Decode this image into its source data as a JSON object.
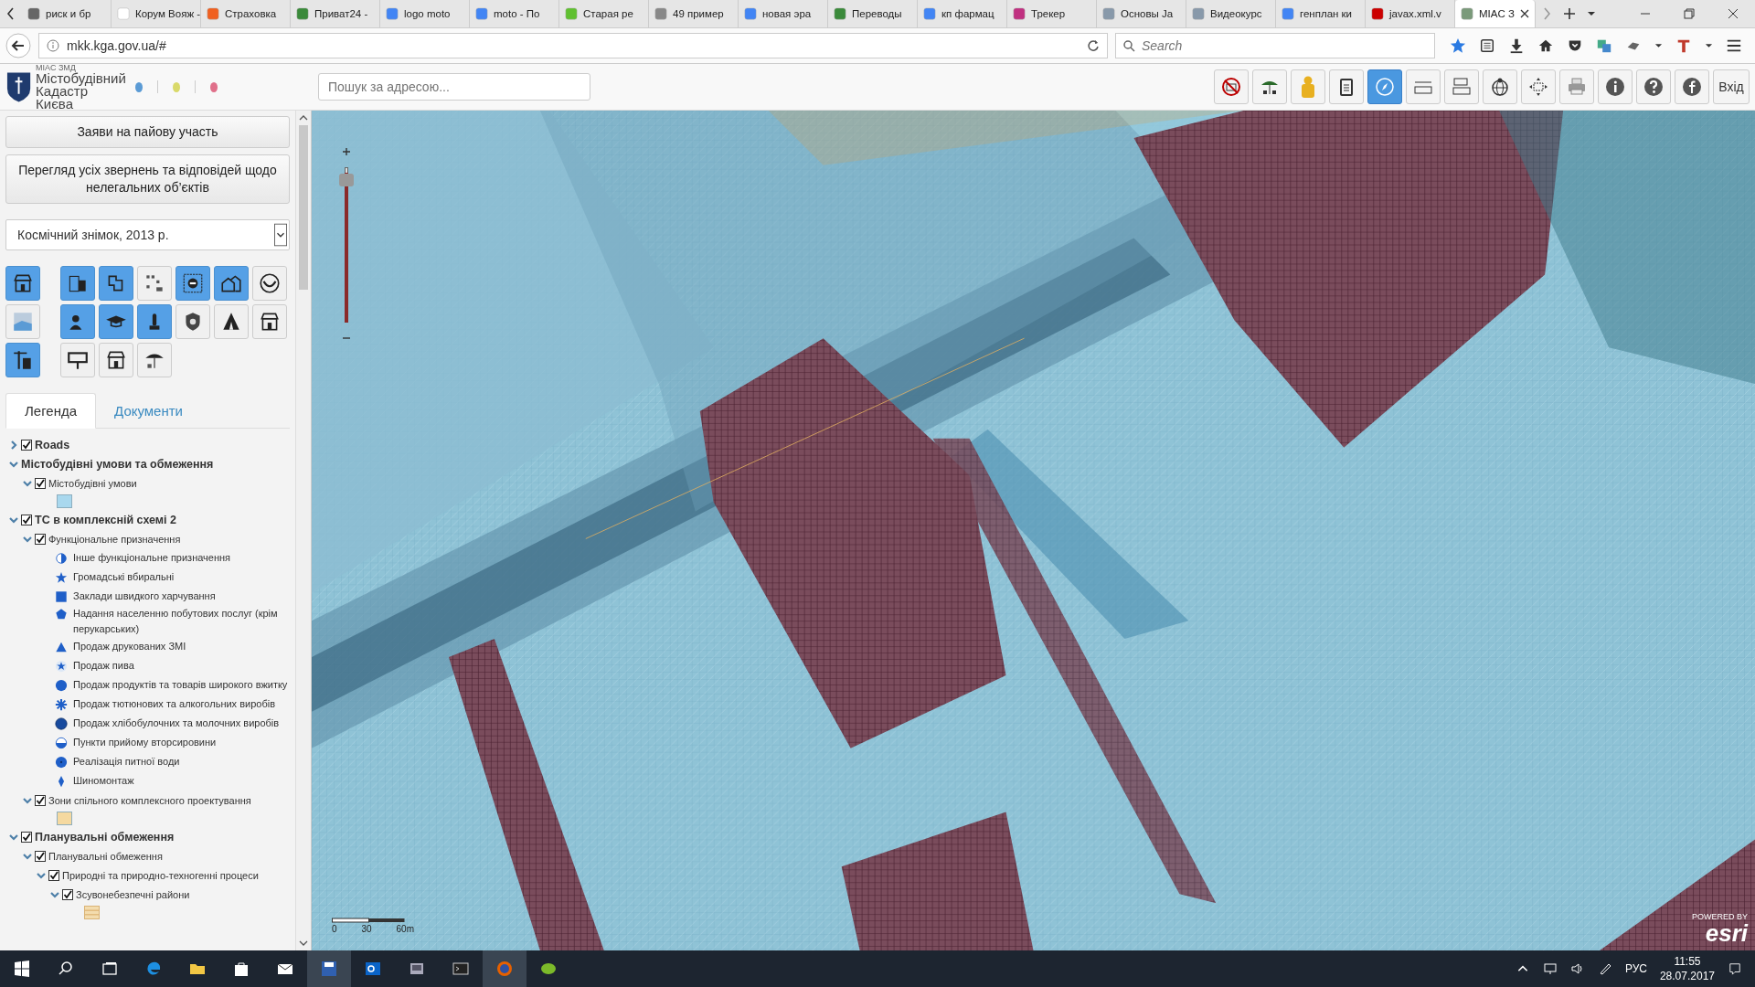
{
  "browser": {
    "tabs": [
      {
        "title": "риск и бр",
        "selected": false
      },
      {
        "title": "Корум Вояж -",
        "selected": false
      },
      {
        "title": "Страховка",
        "selected": false
      },
      {
        "title": "Приват24 -",
        "selected": false
      },
      {
        "title": "logo moto",
        "selected": false
      },
      {
        "title": "moto - По",
        "selected": false
      },
      {
        "title": "Старая ре",
        "selected": false
      },
      {
        "title": "49 пример",
        "selected": false
      },
      {
        "title": "новая эра",
        "selected": false
      },
      {
        "title": "Переводы",
        "selected": false
      },
      {
        "title": "кп фармац",
        "selected": false
      },
      {
        "title": "Трекер",
        "selected": false
      },
      {
        "title": "Основы Ja",
        "selected": false
      },
      {
        "title": "Видеокурс",
        "selected": false
      },
      {
        "title": "генплан ки",
        "selected": false
      },
      {
        "title": "javax.xml.v",
        "selected": false
      },
      {
        "title": "MIAC З",
        "selected": true
      }
    ],
    "url": "mkk.kga.gov.ua/#",
    "search": {
      "placeholder": "Search"
    }
  },
  "header": {
    "logo": {
      "caption": "МІАС ЗМД",
      "line1": "Містобудівний",
      "line2": "Кадастр Києва"
    },
    "dots": [
      {
        "color": "#5b9bd5"
      },
      {
        "color": "#d9d96a"
      },
      {
        "color": "#e0708a"
      }
    ],
    "search": {
      "placeholder": "Пошук за адресою..."
    },
    "tools": [
      {
        "selected": false
      },
      {
        "selected": false
      },
      {
        "selected": false
      },
      {
        "selected": false
      },
      {
        "selected": true
      },
      {
        "selected": false
      },
      {
        "selected": false
      },
      {
        "selected": false
      },
      {
        "selected": false
      },
      {
        "selected": false
      },
      {
        "selected": false
      },
      {
        "selected": false
      },
      {
        "selected": false
      }
    ],
    "login": "Вхід"
  },
  "sidebar": {
    "buttons": [
      "Заяви на пайову участь",
      "Перегляд усіх звернень та відповідей щодо нелегальних об’єктів"
    ],
    "basemap": {
      "value": "Космічний знімок, 2013 р."
    },
    "layer_buttons": [
      {
        "items": [
          {
            "on": true
          },
          {
            "on": true
          },
          {
            "on": true
          },
          {
            "on": false
          },
          {
            "on": true
          },
          {
            "on": true
          },
          {
            "on": false
          }
        ]
      },
      {
        "items": [
          {
            "on": false
          },
          {
            "on": true
          },
          {
            "on": true
          },
          {
            "on": true
          },
          {
            "on": false
          },
          {
            "on": false
          },
          {
            "on": false
          }
        ]
      },
      {
        "items": [
          {
            "on": true
          },
          {
            "on": false
          },
          {
            "on": false
          },
          {
            "on": false
          }
        ]
      }
    ],
    "tabs": [
      {
        "label": "Легенда",
        "selected": true
      },
      {
        "label": "Документи",
        "selected": false
      }
    ],
    "legend": [
      {
        "kind": "layer",
        "label": "Roads",
        "checked": true,
        "expanded": false
      },
      {
        "kind": "heading",
        "label": "Містобудівні умови та обмеження",
        "expanded": true,
        "children": [
          {
            "kind": "layer",
            "label": "Містобудівні умови",
            "checked": true,
            "expanded": true,
            "children": [
              {
                "kind": "swatch",
                "color": "#a9d8ee"
              }
            ]
          }
        ]
      },
      {
        "kind": "layer",
        "label": "ТС в комплексній схемі 2",
        "checked": true,
        "expanded": true,
        "children": [
          {
            "kind": "layer",
            "label": "Функціональне призначення",
            "checked": true,
            "expanded": true,
            "children": [
              {
                "kind": "halfcircle",
                "label": "Інше функціональне призначення"
              },
              {
                "kind": "star",
                "label": "Громадські вбиральні"
              },
              {
                "kind": "square",
                "label": "Заклади швидкого харчування"
              },
              {
                "kind": "pentagon",
                "label": "Надання населенню побутових послуг (крім перукарських)"
              },
              {
                "kind": "triangle",
                "label": "Продаж друкованих ЗМІ"
              },
              {
                "kind": "starcircle",
                "label": "Продаж пива"
              },
              {
                "kind": "circle",
                "label": "Продаж продуктів та товарів широкого вжитку"
              },
              {
                "kind": "asterisk",
                "label": "Продаж тютюнових та алкогольних виробів"
              },
              {
                "kind": "darkcircle",
                "label": "Продаж хлібобулочних та молочних виробів"
              },
              {
                "kind": "halfbottom",
                "label": "Пункти прийому вторсировини"
              },
              {
                "kind": "dotcircle",
                "label": "Реалізація питної води"
              },
              {
                "kind": "diamond",
                "label": "Шиномонтаж"
              }
            ]
          },
          {
            "kind": "layer",
            "label": "Зони спільного комплексного проектування",
            "checked": true,
            "expanded": true,
            "children": [
              {
                "kind": "swatch",
                "color": "#f5d9a0"
              }
            ]
          }
        ]
      },
      {
        "kind": "layer",
        "label": "Планувальні обмеження",
        "checked": true,
        "expanded": true,
        "children": [
          {
            "kind": "layer",
            "label": "Планувальні обмеження",
            "checked": true,
            "expanded": true,
            "children": [
              {
                "kind": "layer",
                "label": "Природні та природно-техногенні процеси",
                "checked": true,
                "expanded": true,
                "children": [
                  {
                    "kind": "layer",
                    "label": "Зсувонебезпечні райони",
                    "checked": true,
                    "expanded": true,
                    "children": [
                      {
                        "kind": "hatch-swatch",
                        "color": "#f3dcae"
                      }
                    ]
                  }
                ]
              }
            ]
          }
        ]
      }
    ]
  },
  "map": {
    "zoom_slider": {
      "level": 0.88
    },
    "scale": [
      "0",
      "30",
      "60m"
    ],
    "attribution": {
      "caption": "POWERED BY",
      "logo": "esri"
    }
  },
  "taskbar": {
    "language": "РУС",
    "time": "11:55",
    "date": "28.07.2017"
  }
}
